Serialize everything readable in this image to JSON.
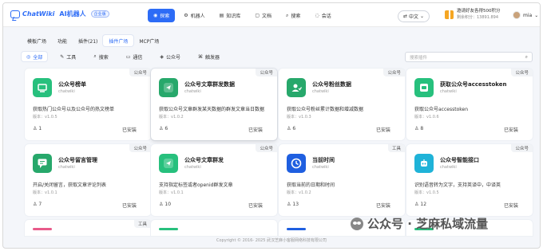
{
  "header": {
    "logo_text": "ChatWiki",
    "logo_ai": "AI机器人",
    "logo_badge": "企业版",
    "nav": [
      {
        "label": "探索",
        "icon": "explore-icon",
        "active": true
      },
      {
        "label": "机器人",
        "icon": "robot-icon",
        "active": false
      },
      {
        "label": "知识库",
        "icon": "book-icon",
        "active": false
      },
      {
        "label": "文档",
        "icon": "document-icon",
        "active": false
      },
      {
        "label": "搜索",
        "icon": "search-icon",
        "active": false
      },
      {
        "label": "会话",
        "icon": "chat-icon",
        "active": false
      }
    ],
    "language": "中文",
    "invite_title": "邀请好友各得500积分",
    "invite_sub": "剩余积分：13891.894",
    "user_name": "mia"
  },
  "tabs": [
    {
      "label": "模板广场",
      "active": false
    },
    {
      "label": "功能",
      "active": false
    },
    {
      "label": "插件(21)",
      "active": false
    },
    {
      "label": "插件广场",
      "active": true
    },
    {
      "label": "MCP广场",
      "active": false
    }
  ],
  "filters": [
    {
      "label": "全部",
      "icon": "all-icon",
      "active": true
    },
    {
      "label": "工具",
      "icon": "tool-icon",
      "active": false
    },
    {
      "label": "搜索",
      "icon": "search-icon",
      "active": false
    },
    {
      "label": "通信",
      "icon": "message-icon",
      "active": false
    },
    {
      "label": "公众号",
      "icon": "official-account-icon",
      "active": false
    },
    {
      "label": "触发器",
      "icon": "trigger-icon",
      "active": false
    }
  ],
  "search_placeholder": "搜索插件",
  "cards": [
    {
      "type": "公众号",
      "title": "公众号榜单",
      "author": "chatwiki",
      "desc": "获取热门公众号以及公众号的热文榜单",
      "version": "版本：v1.0.5",
      "uses": "1",
      "status": "已安装",
      "icon": "ranking-icon",
      "color": "#27c07d"
    },
    {
      "type": "公众号",
      "title": "公众号文章群发数据",
      "author": "chatwiki",
      "desc": "获取公众号文章群发某天数据的群发文章当日数据",
      "version": "版本：v1.0.2",
      "uses": "6",
      "status": "已安装",
      "icon": "send-icon",
      "color": "#27a86b"
    },
    {
      "type": "公众号",
      "title": "公众号粉丝数据",
      "author": "chatwiki",
      "desc": "获取公众号粉丝累计数据和增减数据",
      "version": "版本：v1.0.3",
      "uses": "6",
      "status": "已安装",
      "icon": "fans-icon",
      "color": "#27a86b"
    },
    {
      "type": "公众号",
      "title": "获取公众号accesstoken",
      "author": "chatwiki",
      "desc": "获取公众号accesstoken",
      "version": "版本：v1.0.6",
      "uses": "8",
      "status": "已安装",
      "icon": "token-icon",
      "color": "#27c07d"
    },
    {
      "type": "公众号",
      "title": "公众号留言管理",
      "author": "chatwiki",
      "desc": "开启/关闭留言，获取文章评论列表",
      "version": "版本：v1.0.1",
      "uses": "7",
      "status": "已安装",
      "icon": "comment-icon",
      "color": "#27a86b"
    },
    {
      "type": "公众号",
      "title": "公众号文章群发",
      "author": "chatwiki",
      "desc": "支持指定标签或者openid群发文章",
      "version": "版本：v1.0.1",
      "uses": "10",
      "status": "已安装",
      "icon": "send-icon",
      "color": "#27c07d"
    },
    {
      "type": "工具",
      "title": "当前时间",
      "author": "chatwiki",
      "desc": "获取当前的日期和时间",
      "version": "版本：v1.0.2",
      "uses": "13",
      "status": "已安装",
      "icon": "clock-icon",
      "color": "#1f5fe0"
    },
    {
      "type": "公众号",
      "title": "公众号智能接口",
      "author": "chatwiki",
      "desc": "识别语音转为文字，支持英译中，中译英",
      "version": "版本：v1.0.5",
      "uses": "12",
      "status": "已安装",
      "icon": "ai-robot-icon",
      "color": "#1fb3d8"
    }
  ],
  "stub_cards": [
    {
      "type": "工具",
      "color": "#e85a8a"
    },
    {
      "type": "",
      "color": "#27c07d"
    },
    {
      "type": "",
      "color": "#1f5fe0"
    },
    {
      "type": "",
      "color": "#27c07d"
    }
  ],
  "footer": "Copyright © 2016- 2025 武汉芝麻小客服网络科技有限公司",
  "watermark": "公众号 · 芝麻私域流量"
}
